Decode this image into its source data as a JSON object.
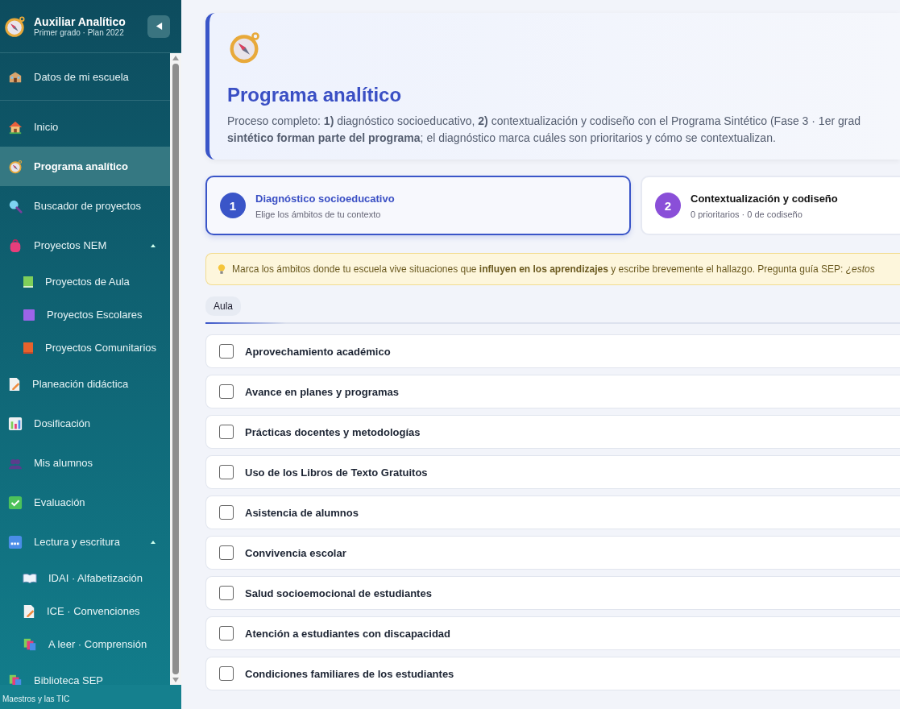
{
  "sidebar": {
    "title": "Auxiliar Analítico",
    "subtitle": "Primer grado · Plan 2022",
    "school_item": {
      "label": "Datos de mi escuela"
    },
    "items": [
      {
        "label": "Inicio",
        "selected": false
      },
      {
        "label": "Programa analítico",
        "selected": true
      },
      {
        "label": "Buscador de proyectos",
        "selected": false
      },
      {
        "label": "Proyectos NEM",
        "selected": false,
        "expanded": true,
        "children": [
          {
            "label": "Proyectos de Aula",
            "selected": false
          },
          {
            "label": "Proyectos Escolares",
            "selected": false
          },
          {
            "label": "Proyectos Comunitarios",
            "selected": false
          }
        ]
      },
      {
        "label": "Planeación didáctica",
        "selected": false
      },
      {
        "label": "Dosificación",
        "selected": false
      },
      {
        "label": "Mis alumnos",
        "selected": false
      },
      {
        "label": "Evaluación",
        "selected": false
      },
      {
        "label": "Lectura y escritura",
        "selected": false,
        "expanded": true,
        "children": [
          {
            "label": "IDAI · Alfabetización",
            "selected": false
          },
          {
            "label": "ICE · Convenciones",
            "selected": false
          },
          {
            "label": "A leer · Comprensión",
            "selected": false
          }
        ]
      },
      {
        "label": "Biblioteca SEP",
        "selected": false
      }
    ],
    "footer": "Maestros y las TIC"
  },
  "header": {
    "title": "Programa analítico",
    "lines": [
      "Proceso completo: **1)** diagnóstico socioeducativo, **2)** contextualización y codiseño con el Programa Sintético (Fase 3 · 1er grad",
      "**sintético forman parte del programa**; el diagnóstico marca cuáles son prioritarios y cómo se contextualizan."
    ]
  },
  "steps": [
    {
      "number": "1",
      "title": "Diagnóstico socioeducativo",
      "subtitle": "Elige los ámbitos de tu contexto",
      "selected": true
    },
    {
      "number": "2",
      "title": "Contextualización y codiseño",
      "subtitle": "0 prioritarios · 0 de codiseño",
      "selected": false
    }
  ],
  "hint": "Marca los ámbitos donde tu escuela vive situaciones que **influyen en los aprendizajes** y escribe brevemente el hallazgo. Pregunta guía SEP: *¿estos*",
  "tabs": [
    {
      "label": "Aula",
      "selected": true
    }
  ],
  "areas": [
    {
      "label": "Aprovechamiento académico",
      "checked": false
    },
    {
      "label": "Avance en planes y programas",
      "checked": false
    },
    {
      "label": "Prácticas docentes y metodologías",
      "checked": false
    },
    {
      "label": "Uso de los Libros de Texto Gratuitos",
      "checked": false
    },
    {
      "label": "Asistencia de alumnos",
      "checked": false
    },
    {
      "label": "Convivencia escolar",
      "checked": false
    },
    {
      "label": "Salud socioemocional de estudiantes",
      "checked": false
    },
    {
      "label": "Atención a estudiantes con discapacidad",
      "checked": false
    },
    {
      "label": "Condiciones familiares de los estudiantes",
      "checked": false
    }
  ]
}
